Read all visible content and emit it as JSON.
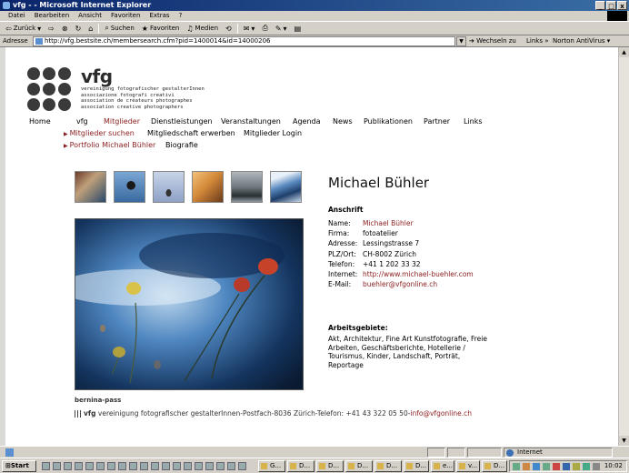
{
  "window": {
    "title": "vfg - - Microsoft Internet Explorer",
    "buttons": [
      "_",
      "□",
      "x"
    ]
  },
  "menu": [
    "Datei",
    "Bearbeiten",
    "Ansicht",
    "Favoriten",
    "Extras",
    "?"
  ],
  "toolbar": {
    "back": "Zurück",
    "search": "Suchen",
    "favorites": "Favoriten",
    "media": "Medien"
  },
  "address": {
    "label": "Adresse",
    "url": "http://vfg.bestsite.ch/membersearch.cfm?pid=1400014&id=14000206",
    "go": "Wechseln zu",
    "links": "Links",
    "norton": "Norton AntiVirus"
  },
  "site": {
    "logo": "vfg",
    "tagline": [
      "vereinigung fotografischer gestalterInnen",
      "associazione fotografi creativi",
      "association de créateurs photographes",
      "association creative photographers"
    ],
    "nav": [
      "Home",
      "vfg",
      "Mitglieder",
      "Dienstleistungen",
      "Veranstaltungen",
      "Agenda",
      "News",
      "Publikationen",
      "Partner",
      "Links"
    ],
    "subnav1": [
      "Mitglieder suchen",
      "Mitgliedschaft erwerben",
      "Mitglieder Login"
    ],
    "subnav2": [
      "Portfolio Michael Bühler",
      "Biografie"
    ]
  },
  "profile": {
    "name": "Michael Bühler",
    "address_heading": "Anschrift",
    "address": [
      {
        "k": "Name:",
        "v": "Michael Bühler"
      },
      {
        "k": "Firma:",
        "v": "fotoatelier"
      },
      {
        "k": "Adresse:",
        "v": "Lessingstrasse 7"
      },
      {
        "k": "PLZ/Ort:",
        "v": "CH-8002 Zürich"
      },
      {
        "k": "Telefon:",
        "v": "+41 1 202 33 32"
      },
      {
        "k": "Internet:",
        "v": "http://www.michael-buehler.com"
      },
      {
        "k": "E-Mail:",
        "v": "buehler@vfgonline.ch"
      }
    ],
    "areas_heading": "Arbeitsgebiete:",
    "areas": "Akt, Architektur, Fine Art Kunstfotografie, Freie Arbeiten, Geschäftsberichte, Hotellerie / Tourismus, Kinder, Landschaft, Porträt, Reportage"
  },
  "photo_caption": "bernina-pass",
  "footer": {
    "logo": "vfg",
    "text": "vereinigung fotografischer gestalterInnen-Postfach-8036 Zürich-Telefon: +41 43 322 05 50-",
    "email": "info@vfgonline.ch"
  },
  "status": {
    "zone": "Internet"
  },
  "taskbar": {
    "start": "Start",
    "tasks": [
      "G...",
      "D...",
      "D...",
      "D...",
      "D...",
      "D...",
      "e...",
      "v...",
      "D..."
    ],
    "clock": "10:02"
  },
  "colors": {
    "accent": "#8b1e1e",
    "titlebar": "#0a246a",
    "chrome": "#d4d0c8"
  }
}
